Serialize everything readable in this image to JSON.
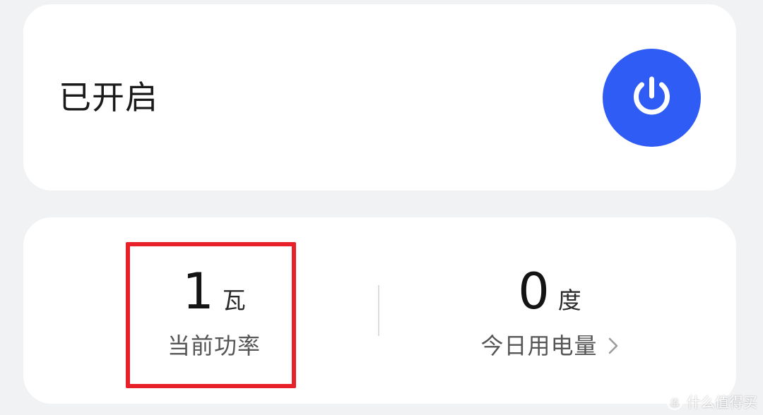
{
  "colors": {
    "page_background": "#f1f2f4",
    "card_background": "#ffffff",
    "power_button": "#2f5cf5",
    "highlight_box": "#e8202a"
  },
  "status_card": {
    "status_text": "已开启",
    "power_button_icon": "power-icon"
  },
  "stats_card": {
    "current_power": {
      "value": "1",
      "unit": "瓦",
      "label": "当前功率"
    },
    "today_energy": {
      "value": "0",
      "unit": "度",
      "label": "今日用电量",
      "icon": "chevron-right-icon"
    }
  },
  "watermark": {
    "text": "什么值得买",
    "icon": "smzdm-logo"
  }
}
